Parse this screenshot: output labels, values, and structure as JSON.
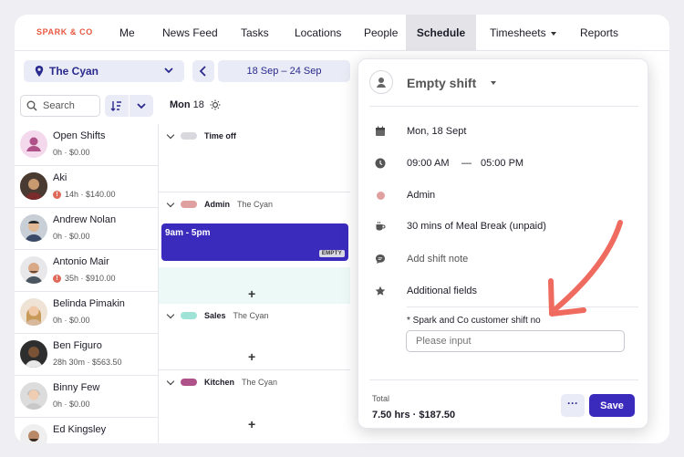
{
  "brand": {
    "logo": "SPARK & CO"
  },
  "nav": [
    {
      "label": "Me"
    },
    {
      "label": "News Feed"
    },
    {
      "label": "Tasks"
    },
    {
      "label": "Locations"
    },
    {
      "label": "People"
    },
    {
      "label": "Schedule",
      "active": true
    },
    {
      "label": "Timesheets",
      "dropdown": true
    },
    {
      "label": "Reports"
    }
  ],
  "toolbar": {
    "location": "The Cyan",
    "date_range": "18 Sep – 24 Sep",
    "search_placeholder": "Search"
  },
  "day": {
    "label": "Mon",
    "date": "18"
  },
  "staff": [
    {
      "name": "Open Shifts",
      "meta": "0h · $0.00",
      "warning": false,
      "avatar": "open-shifts-icon"
    },
    {
      "name": "Aki",
      "meta": "14h · $140.00",
      "warning": true
    },
    {
      "name": "Andrew Nolan",
      "meta": "0h · $0.00",
      "warning": false
    },
    {
      "name": "Antonio Mair",
      "meta": "35h · $910.00",
      "warning": true
    },
    {
      "name": "Belinda Pimakin",
      "meta": "0h · $0.00",
      "warning": false
    },
    {
      "name": "Ben Figuro",
      "meta": "28h 30m · $563.50",
      "warning": false
    },
    {
      "name": "Binny Few",
      "meta": "0h · $0.00",
      "warning": false
    },
    {
      "name": "Ed Kingsley",
      "meta": "",
      "warning": false
    }
  ],
  "sections": [
    {
      "name": "Time off",
      "location": "",
      "color": "#d8d8de"
    },
    {
      "name": "Admin",
      "location": "The Cyan",
      "color": "#e0a0a0"
    },
    {
      "name": "Sales",
      "location": "The Cyan",
      "color": "#9fe3d6"
    },
    {
      "name": "Kitchen",
      "location": "The Cyan",
      "color": "#b0528a"
    }
  ],
  "shift_block": {
    "time": "9am - 5pm",
    "badge": "EMPTY"
  },
  "popup": {
    "title": "Empty shift",
    "date": "Mon, 18 Sept",
    "start": "09:00 AM",
    "separator": "—",
    "end": "05:00 PM",
    "role": "Admin",
    "break": "30 mins of Meal Break (unpaid)",
    "note_placeholder": "Add shift note",
    "additional_fields": "Additional fields",
    "custom_field_label": "* Spark and Co customer shift no",
    "custom_field_placeholder": "Please input",
    "total_label": "Total",
    "total_value": "7.50 hrs · $187.50",
    "more_label": "···",
    "save_label": "Save"
  },
  "colors": {
    "accent": "#3b2bbd",
    "arrow": "#f06b5f",
    "logo": "#e8573f"
  }
}
